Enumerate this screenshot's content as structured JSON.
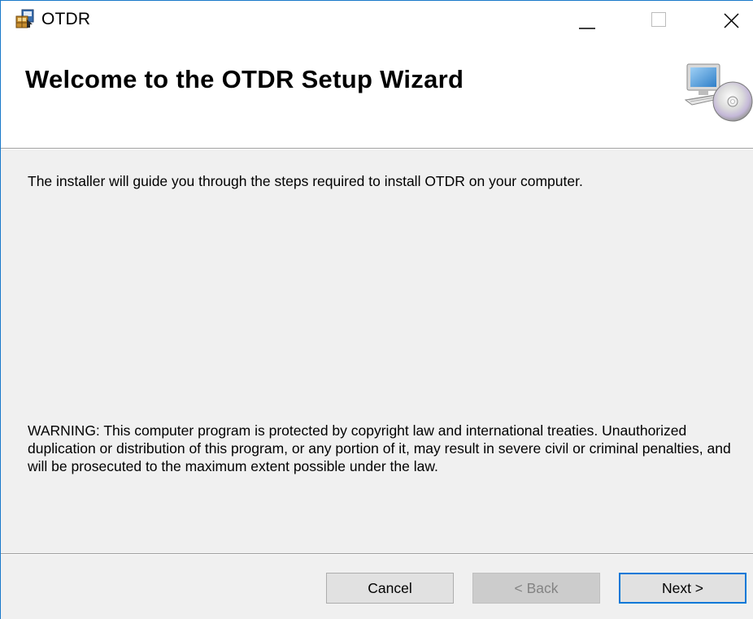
{
  "window": {
    "title": "OTDR",
    "icon": "installer-icon",
    "controls": {
      "minimize": "minimize-icon",
      "maximize": "maximize-icon",
      "close": "close-icon"
    }
  },
  "banner": {
    "title": "Welcome to the OTDR Setup Wizard",
    "graphic": "computer-cd-icon"
  },
  "body": {
    "intro": "The installer will guide you through the steps required to install OTDR on your computer.",
    "warning": "WARNING: This computer program is protected by copyright law and international treaties. Unauthorized duplication or distribution of this program, or any portion of it, may result in severe civil or criminal penalties, and will be prosecuted to the maximum extent possible under the law."
  },
  "buttons": {
    "cancel": "Cancel",
    "back": "< Back",
    "next": "Next >"
  },
  "colors": {
    "window_border": "#1979ca",
    "focus_border": "#0078d7",
    "background": "#f0f0f0"
  }
}
